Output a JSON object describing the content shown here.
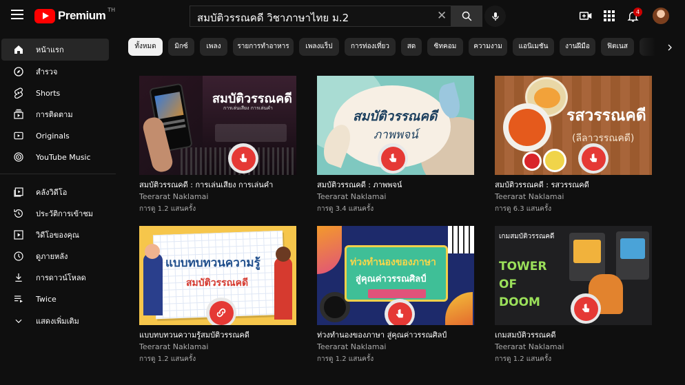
{
  "header": {
    "logo_text": "Premium",
    "logo_superscript": "TH",
    "search_value": "สมบัติวรรณคดี  วิชาภาษาไทย ม.2",
    "notification_count": "4"
  },
  "sidebar": {
    "items": [
      {
        "label": "หน้าแรก",
        "icon": "home-icon"
      },
      {
        "label": "สำรวจ",
        "icon": "explore-icon"
      },
      {
        "label": "Shorts",
        "icon": "shorts-icon"
      },
      {
        "label": "การติดตาม",
        "icon": "subscriptions-icon"
      },
      {
        "label": "Originals",
        "icon": "originals-icon"
      },
      {
        "label": "YouTube Music",
        "icon": "youtube-music-icon"
      },
      {
        "label": "คลังวิดีโอ",
        "icon": "library-icon"
      },
      {
        "label": "ประวัติการเข้าชม",
        "icon": "history-icon"
      },
      {
        "label": "วิดีโอของคุณ",
        "icon": "your-videos-icon"
      },
      {
        "label": "ดูภายหลัง",
        "icon": "watch-later-icon"
      },
      {
        "label": "การดาวน์โหลด",
        "icon": "downloads-icon"
      },
      {
        "label": "Twice",
        "icon": "playlist-icon"
      },
      {
        "label": "แสดงเพิ่มเติม",
        "icon": "chevron-down-icon"
      }
    ]
  },
  "chips": [
    "ทั้งหมด",
    "มิกซ์",
    "เพลง",
    "รายการทำอาหาร",
    "เพลงแร็ป",
    "การท่องเที่ยว",
    "สด",
    "ซิทคอม",
    "ความงาม",
    "แอนิเมชัน",
    "งานฝีมือ",
    "ฟิตเนส"
  ],
  "videos": [
    {
      "title": "สมบัติวรรณคดี : การเล่นเสียง การเล่นคำ",
      "channel": "Teerarat Naklamai",
      "views": "การดู  1.2 แสนครั้ง",
      "thumb_title": "สมบัติวรรณคดี",
      "thumb_sub": "การเล่นเสียง  การเล่นคำ"
    },
    {
      "title": "สมบัติวรรณคดี : ภาพพจน์",
      "channel": "Teerarat Naklamai",
      "views": "การดู  3.4 แสนครั้ง",
      "thumb_title": "สมบัติวรรณคดี",
      "thumb_sub": "ภาพพจน์"
    },
    {
      "title": "สมบัติวรรณคดี : รสวรรณคดี",
      "channel": "Teerarat Naklamai",
      "views": "การดู  6.3 แสนครั้ง",
      "thumb_title": "รสวรรณคดี",
      "thumb_sub": "(ลีลาวรรณคดี)"
    },
    {
      "title": "แบบทบทวนความรู้สมบัติวรรณคดี",
      "channel": "Teerarat Naklamai",
      "views": "การดู  1.2 แสนครั้ง",
      "thumb_title": "แบบทบทวนความรู้",
      "thumb_sub": "สมบัติวรรณคดี"
    },
    {
      "title": "ท่วงทำนองของภาษา สู่คุณค่าวรรณศิลป์",
      "channel": "Teerarat Naklamai",
      "views": "การดู  1.2 แสนครั้ง",
      "thumb_title": "ท่วงทำนองของภาษา",
      "thumb_sub": "สู่คุณค่าวรรณศิลป์"
    },
    {
      "title": "เกมสมบัติวรรณคดี",
      "channel": "Teerarat Naklamai",
      "views": "การดู  1.2 แสนครั้ง",
      "thumb_title": "เกมสมบัติวรรณคดี",
      "thumb_sub": "TOWER OF DOOM"
    }
  ],
  "colors": {
    "background": "#0f0f0f",
    "chip": "#272727",
    "chip_active": "#f1f1f1",
    "brand_red": "#ff0000",
    "link_badge": "#e53935"
  }
}
